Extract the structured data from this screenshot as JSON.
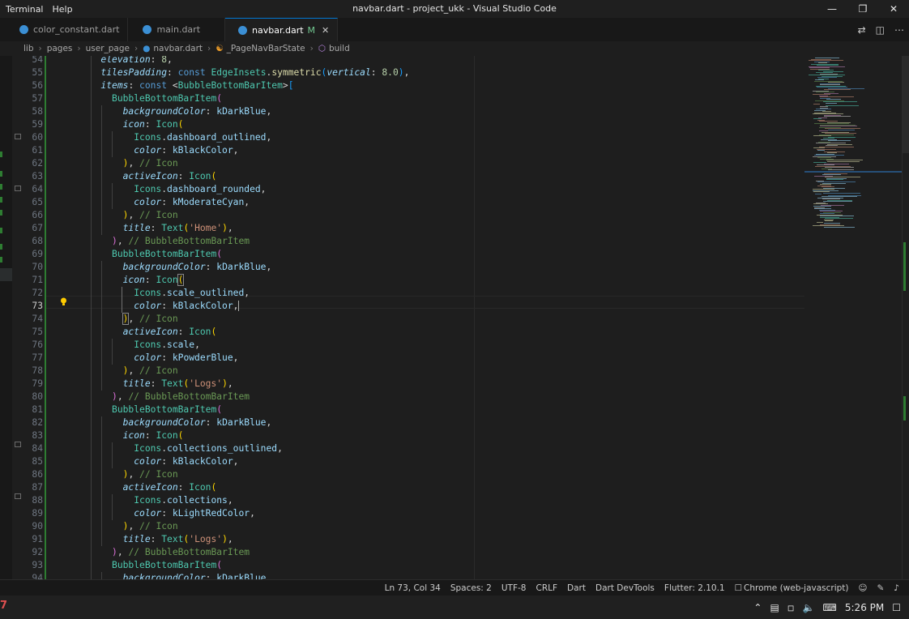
{
  "window": {
    "title": "navbar.dart - project_ukk - Visual Studio Code",
    "menu": [
      "Terminal",
      "Help"
    ]
  },
  "tabs": [
    {
      "label": "color_constant.dart"
    },
    {
      "label": "main.dart"
    },
    {
      "label": "navbar.dart",
      "modified": "M"
    }
  ],
  "breadcrumb": [
    "lib",
    "pages",
    "user_page",
    "navbar.dart",
    "_PageNavBarState",
    "build"
  ],
  "editor": {
    "line_numbers": [
      "54",
      "55",
      "56",
      "57",
      "58",
      "59",
      "60",
      "61",
      "62",
      "63",
      "64",
      "65",
      "66",
      "67",
      "68",
      "69",
      "70",
      "71",
      "72",
      "73",
      "74",
      "75",
      "76",
      "77",
      "78",
      "79",
      "80",
      "81",
      "82",
      "83",
      "84",
      "85",
      "86",
      "87",
      "88",
      "89",
      "90",
      "91",
      "92",
      "93",
      "94"
    ],
    "current_line": "73"
  },
  "status": {
    "position": "Ln 73, Col 34",
    "spaces": "Spaces: 2",
    "encoding": "UTF-8",
    "eol": "CRLF",
    "language": "Dart",
    "devtools": "Dart DevTools",
    "flutter": "Flutter: 2.10.1",
    "device": "Chrome (web-javascript)"
  },
  "taskbar": {
    "left_glyph": "7",
    "time": "5:26 PM"
  },
  "colors": {
    "accent": "#0078d4",
    "modified": "#73c991",
    "gutter_added": "#2e7d32"
  }
}
